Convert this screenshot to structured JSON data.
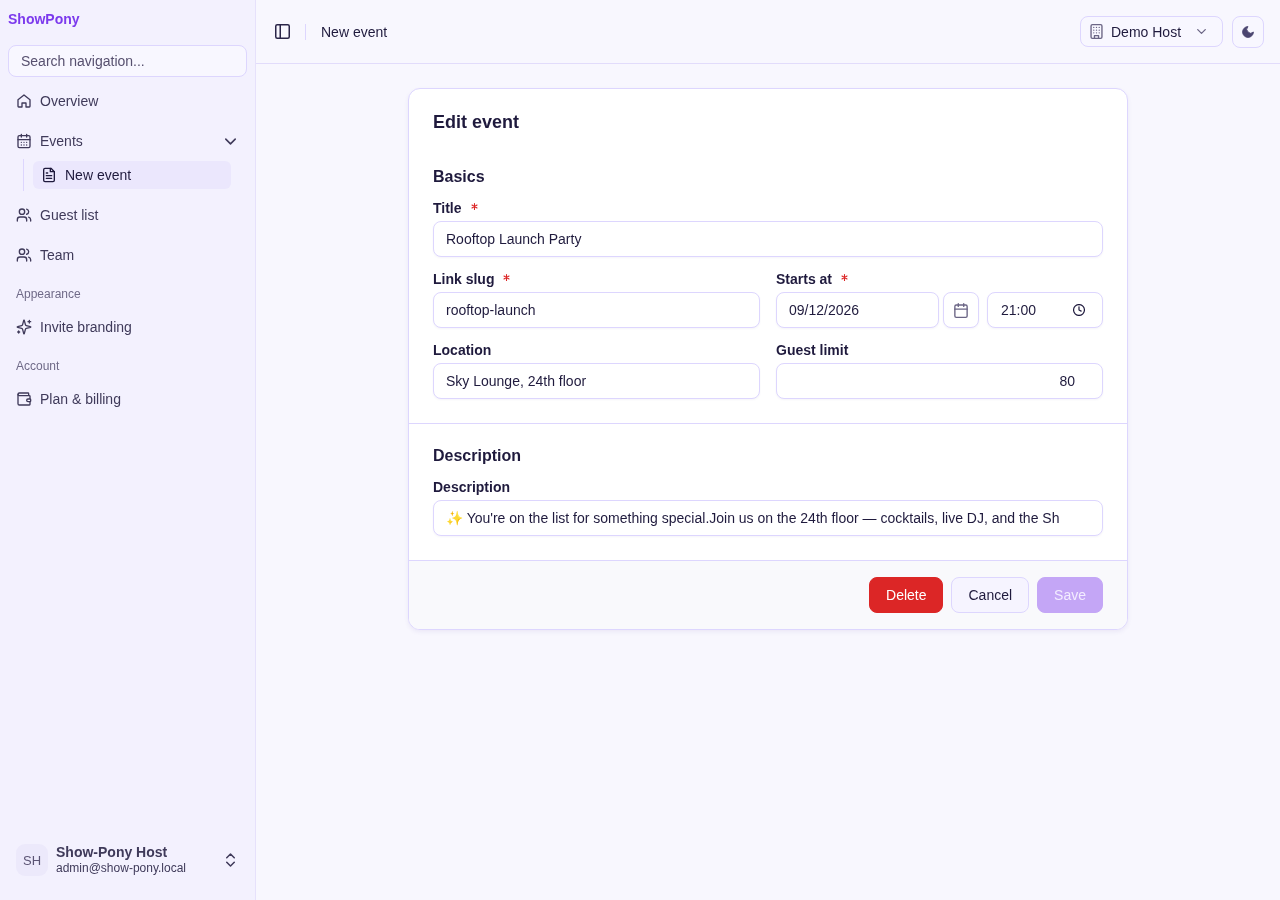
{
  "sidebar": {
    "brand": "ShowPony",
    "search": {
      "placeholder": "Search navigation..."
    },
    "sections": [
      {
        "items": [
          {
            "label": "Overview",
            "selected": false
          },
          {
            "label": "Events",
            "selected": false,
            "expanded": true,
            "children": [
              {
                "label": "New event",
                "selected": true
              }
            ]
          },
          {
            "label": "Guest list",
            "selected": false
          },
          {
            "label": "Team",
            "selected": false
          }
        ]
      },
      {
        "heading": "Appearance",
        "items": [
          {
            "label": "Invite branding",
            "selected": false
          }
        ]
      },
      {
        "heading": "Account",
        "items": [
          {
            "label": "Plan & billing",
            "selected": false
          }
        ]
      }
    ],
    "user": {
      "initials": "SH",
      "name": "Show-Pony Host",
      "email": "admin@show-pony.local"
    }
  },
  "header": {
    "breadcrumb": "New event",
    "workspace": {
      "label": "Demo Host"
    }
  },
  "form": {
    "title": "Edit event",
    "sections": [
      {
        "heading": "Basics",
        "rows": [
          [
            {
              "kind": "text",
              "label": "Title",
              "required": true,
              "value": "Rooftop Launch Party"
            }
          ],
          [
            {
              "kind": "text",
              "label": "Link slug",
              "required": true,
              "value": "rooftop-launch"
            },
            {
              "kind": "datetime",
              "label": "Starts at",
              "required": true,
              "date": "09/12/2026",
              "time": "21:00"
            }
          ],
          [
            {
              "kind": "text",
              "label": "Location",
              "required": false,
              "value": "Sky Lounge, 24th floor"
            },
            {
              "kind": "number",
              "label": "Guest limit",
              "required": false,
              "value": "80"
            }
          ]
        ]
      },
      {
        "heading": "Description",
        "rows": [
          [
            {
              "kind": "text",
              "label": "Description",
              "required": false,
              "value": "✨ You're on the list for something special.Join us on the 24th floor — cocktails, live DJ, and the Sh"
            }
          ]
        ]
      }
    ],
    "buttons": [
      {
        "label": "Delete",
        "kind": "danger",
        "disabled": false
      },
      {
        "label": "Cancel",
        "kind": "secondary",
        "disabled": false
      },
      {
        "label": "Save",
        "kind": "primary",
        "disabled": true
      }
    ]
  }
}
